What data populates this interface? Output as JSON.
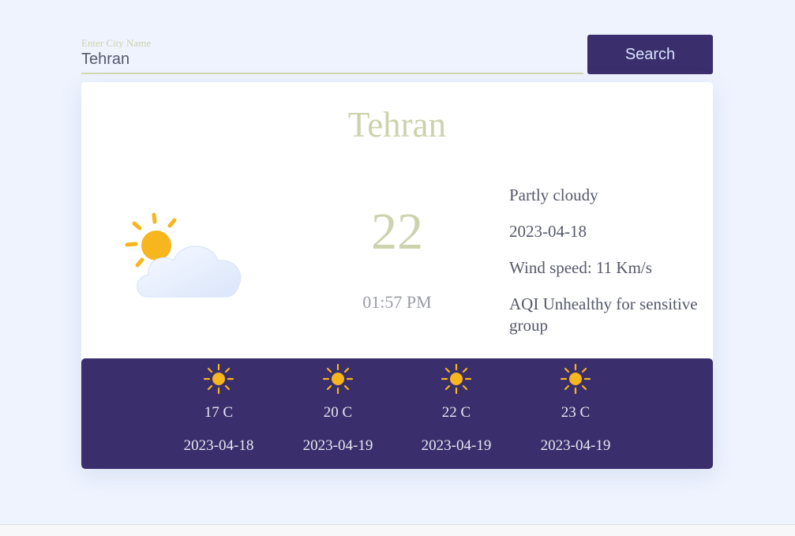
{
  "search": {
    "label": "Enter City Name",
    "value": "Tehran",
    "button_label": "Search"
  },
  "current": {
    "city": "Tehran",
    "temperature": "22",
    "time": "01:57 PM",
    "icon": "partly-cloudy-icon",
    "condition": "Partly cloudy",
    "date": "2023-04-18",
    "wind": "Wind speed: 11 Km/s",
    "aqi": "AQI Unhealthy for sensitive group"
  },
  "forecast": [
    {
      "icon": "sun-icon",
      "temp": "17 C",
      "date": "2023-04-18"
    },
    {
      "icon": "sun-icon",
      "temp": "20 C",
      "date": "2023-04-19"
    },
    {
      "icon": "sun-icon",
      "temp": "22 C",
      "date": "2023-04-19"
    },
    {
      "icon": "sun-icon",
      "temp": "23 C",
      "date": "2023-04-19"
    }
  ],
  "colors": {
    "accent": "#3a2f6c",
    "title": "#ccd3ac",
    "background": "#eef3fe"
  }
}
